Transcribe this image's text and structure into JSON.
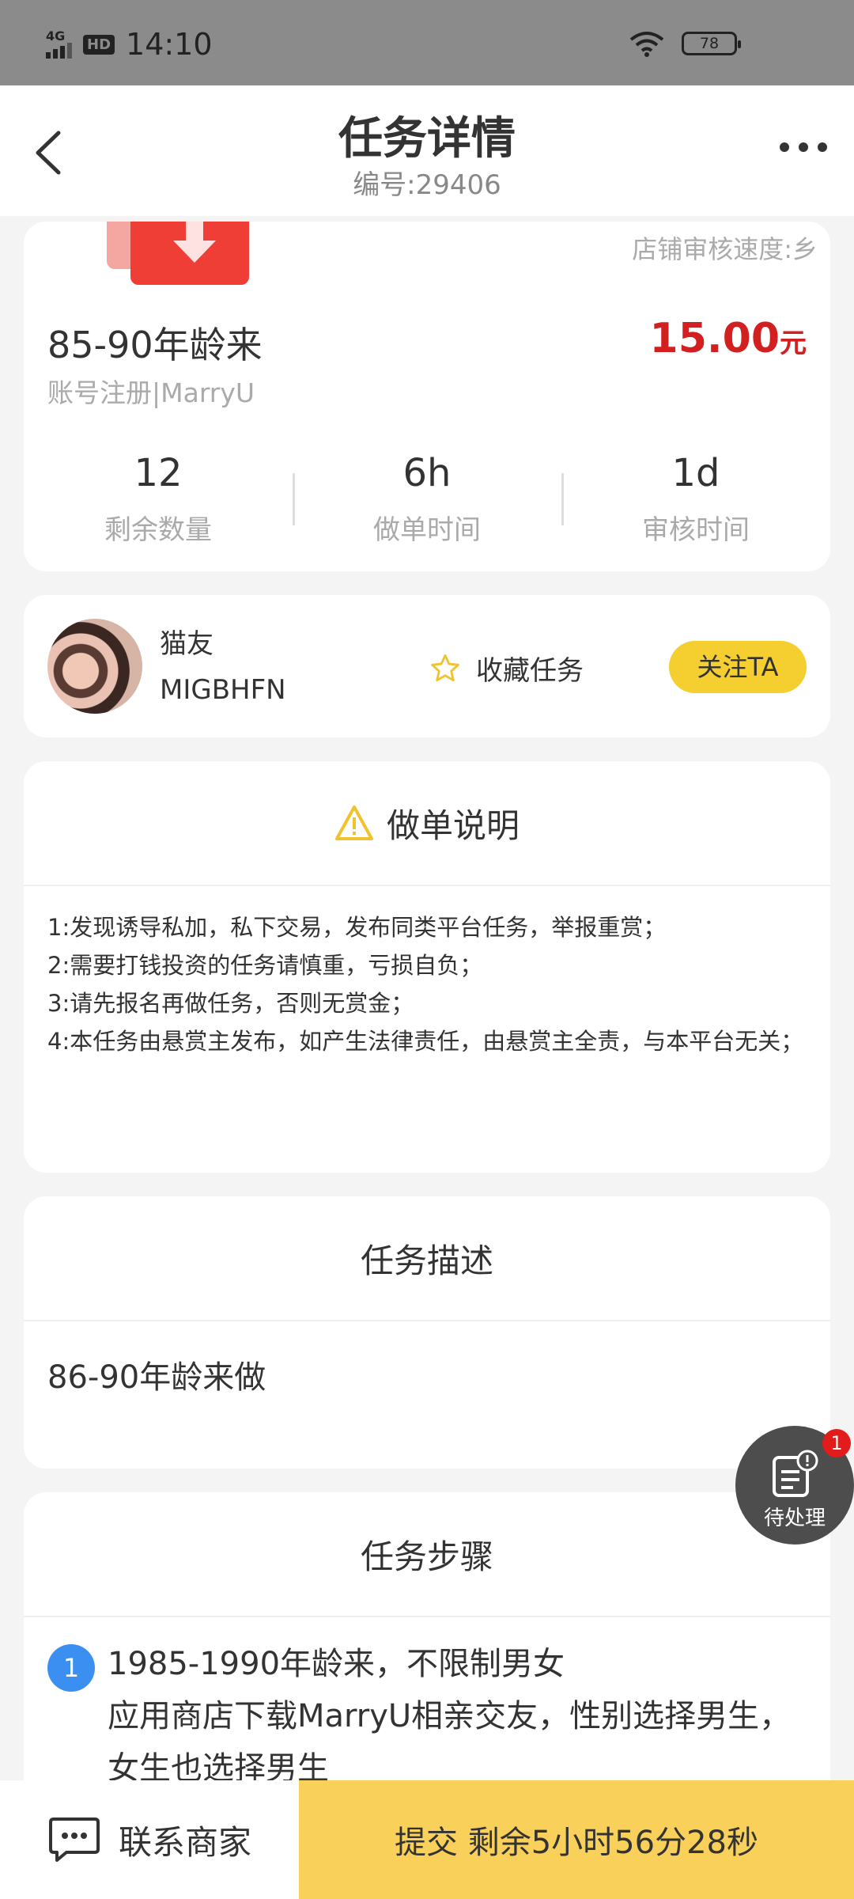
{
  "status_bar": {
    "network": "4G",
    "hd": "HD",
    "time": "14:10",
    "battery": "78"
  },
  "nav": {
    "title": "任务详情",
    "subtitle": "编号:29406"
  },
  "task": {
    "audit_speed": "店铺审核速度:乡",
    "title": "85-90年龄来",
    "price": "15.00",
    "price_unit": "元",
    "subtitle": "账号注册|MarryU",
    "stats": [
      {
        "value": "12",
        "label": "剩余数量"
      },
      {
        "value": "6h",
        "label": "做单时间"
      },
      {
        "value": "1d",
        "label": "审核时间"
      }
    ]
  },
  "publisher": {
    "name": "猫友",
    "id": "MIGBHFN",
    "favorite_label": "收藏任务",
    "follow_label": "关注TA"
  },
  "instructions": {
    "title": "做单说明",
    "items": [
      "1:发现诱导私加，私下交易，发布同类平台任务，举报重赏；",
      "2:需要打钱投资的任务请慎重，亏损自负；",
      "3:请先报名再做任务，否则无赏金；",
      "4:本任务由悬赏主发布，如产生法律责任，由悬赏主全责，与本平台无关；"
    ]
  },
  "description": {
    "title": "任务描述",
    "text": "86-90年龄来做"
  },
  "steps": {
    "title": "任务步骤",
    "items": [
      {
        "num": "1",
        "line1": "1985-1990年龄来，不限制男女",
        "line2": "应用商店下载MarryU相亲交友，性别选择男生，女生也选择男生"
      }
    ]
  },
  "floating": {
    "label": "待处理",
    "badge": "1"
  },
  "bottom": {
    "contact_label": "联系商家",
    "submit_label": "提交 剩余5小时56分28秒"
  },
  "colors": {
    "accent_yellow": "#f4cf2f",
    "price_red": "#d21f1f",
    "step_blue": "#3b8ff0"
  }
}
